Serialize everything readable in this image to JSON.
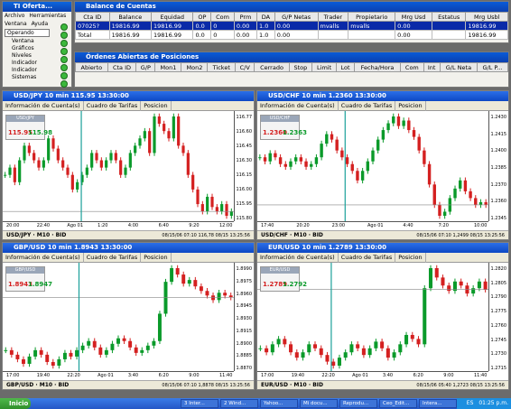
{
  "nav_panel": {
    "title": "TI Oferta...",
    "menu": [
      "Archivo",
      "Herramientas",
      "Ventana",
      "Ayuda"
    ],
    "dropdown": "Operando",
    "tree": [
      "Ventana",
      "Gráficos",
      "Niveles",
      "Indicador",
      "Indicador",
      "Sistemas"
    ]
  },
  "accounts": {
    "title": "Balance de Cuentas",
    "headers": [
      "Cta ID",
      "Balance",
      "Equidad",
      "OP",
      "Com",
      "Prm",
      "DA",
      "G/P Netas",
      "Trader",
      "Propietario",
      "Mrg Usd",
      "Estatus",
      "Mrg Usbl"
    ],
    "rows": [
      {
        "cells": [
          "07025?",
          "19816.99",
          "19816.99",
          "0.0",
          "0",
          "0.00",
          "1.0",
          "0.00",
          "mvalls",
          "mvalls",
          "0.00",
          "",
          "19816.99"
        ]
      },
      {
        "cells": [
          "Total",
          "19816.99",
          "19816.99",
          "0.0",
          "0",
          "0.00",
          "1.0",
          "0.00",
          "",
          "",
          "0.00",
          "",
          "19816.99"
        ]
      }
    ]
  },
  "orders": {
    "title": "Órdenes Abiertas de Posiciones",
    "headers": [
      "Abierto",
      "Cta ID",
      "G/P",
      "Mon1",
      "Mon2",
      "Ticket",
      "C/V",
      "Cerrado",
      "Stop",
      "Limit",
      "Lot",
      "Fecha/Hora",
      "Com",
      "Int",
      "G/L Neta",
      "G/L P..."
    ]
  },
  "charts": [
    {
      "title": "USD/JPY 10 min 115.95 13:30:00",
      "tabs": [
        "Información de Cuenta(s)",
        "Cuadro de Tarifas",
        "Posicion"
      ],
      "pair": "USD/JPY",
      "sell": "115.95",
      "buy": "115.98",
      "status": "USD/JPY · M10 · BID",
      "footer": "08/15/06 07:10  116,78  08/15 13:25:56",
      "yticks": [
        "116.77",
        "116.60",
        "116.45",
        "116.30",
        "116.15",
        "116.00",
        "115.95",
        "115.80"
      ],
      "xticks": [
        "20:00",
        "22:40",
        "Ago 01",
        "1:20",
        "4:00",
        "6:40",
        "9:20",
        "12:00"
      ],
      "last": "115.95",
      "prices": [
        116.2,
        116.25,
        116.15,
        116.3,
        116.4,
        116.35,
        116.3,
        116.25,
        116.3,
        116.45,
        116.38,
        116.3,
        116.25,
        116.2,
        116.1,
        116.15,
        116.2,
        116.25,
        116.35,
        116.3,
        116.25,
        116.3,
        116.35,
        116.3,
        116.2,
        116.25,
        116.35,
        116.4,
        116.45,
        116.5,
        116.35,
        116.6,
        116.55,
        116.5,
        116.45,
        116.6,
        116.4,
        116.35,
        116.2,
        116.1,
        116.0,
        115.95,
        116.05,
        115.98,
        115.95,
        116.0,
        115.92,
        115.95
      ]
    },
    {
      "title": "USD/CHF 10 min 1.2360 13:30:00",
      "tabs": [
        "Información de Cuenta(s)",
        "Cuadro de Tarifas",
        "Posicion"
      ],
      "pair": "USD/CHF",
      "sell": "1.2360",
      "buy": "1.2363",
      "status": "USD/CHF · M10 · BID",
      "footer": "08/15/06 07:10  1,2499  08/15 13:25:56",
      "yticks": [
        "1.2430",
        "1.2415",
        "1.2400",
        "1.2385",
        "1.2370",
        "1.2360",
        "1.2345"
      ],
      "xticks": [
        "17:40",
        "20:20",
        "23:00",
        "Ago 01",
        "4:40",
        "7:20",
        "10:00"
      ],
      "last": "1.2360",
      "prices": [
        1.2395,
        1.2392,
        1.2398,
        1.2395,
        1.239,
        1.2388,
        1.2392,
        1.2395,
        1.2392,
        1.2388,
        1.239,
        1.2395,
        1.2405,
        1.2412,
        1.2408,
        1.24,
        1.2395,
        1.239,
        1.2385,
        1.2378,
        1.2385,
        1.2392,
        1.24,
        1.2408,
        1.2415,
        1.242,
        1.2425,
        1.2418,
        1.2422,
        1.2415,
        1.241,
        1.24,
        1.239,
        1.2375,
        1.236,
        1.2352,
        1.2355,
        1.2365,
        1.2372,
        1.2378,
        1.237,
        1.2365,
        1.236,
        1.2362,
        1.236
      ]
    },
    {
      "title": "GBP/USD 10 min 1.8943 13:30:00",
      "tabs": [
        "Información de Cuenta(s)",
        "Cuadro de Tarifas",
        "Posicion"
      ],
      "pair": "GBP/USD",
      "sell": "1.8943",
      "buy": "1.8947",
      "status": "GBP/USD · M10 · BID",
      "footer": "08/15/06 07:10  1,8878  08/15 13:25:56",
      "yticks": [
        "1.8990",
        "1.8975",
        "1.8960",
        "1.8945",
        "1.8930",
        "1.8915",
        "1.8900",
        "1.8885",
        "1.8870"
      ],
      "xticks": [
        "17:00",
        "19:40",
        "22:20",
        "Ago 01",
        "3:40",
        "6:20",
        "9:00",
        "11:40"
      ],
      "last": "1.8943",
      "prices": [
        1.8885,
        1.888,
        1.8875,
        1.887,
        1.8878,
        1.8885,
        1.888,
        1.8872,
        1.8868,
        1.8875,
        1.8882,
        1.8878,
        1.8885,
        1.889,
        1.8895,
        1.8888,
        1.888,
        1.8885,
        1.8892,
        1.8898,
        1.8895,
        1.8888,
        1.8882,
        1.8885,
        1.889,
        1.8895,
        1.8925,
        1.896,
        1.8975,
        1.8968,
        1.8958,
        1.8962,
        1.8955,
        1.895,
        1.8945,
        1.894,
        1.8948,
        1.8945,
        1.8943
      ]
    },
    {
      "title": "EUR/USD 10 min 1.2789 13:30:00",
      "tabs": [
        "Información de Cuenta(s)",
        "Cuadro de Tarifas",
        "Posicion"
      ],
      "pair": "EUR/USD",
      "sell": "1.2789",
      "buy": "1.2792",
      "status": "EUR/USD · M10 · BID",
      "footer": "08/15/06 05:40  1,2723  08/15 13:25:56",
      "yticks": [
        "1.2820",
        "1.2805",
        "1.2790",
        "1.2775",
        "1.2760",
        "1.2745",
        "1.2730",
        "1.2715"
      ],
      "xticks": [
        "17:00",
        "19:40",
        "22:20",
        "Ago 01",
        "3:40",
        "6:20",
        "9:00",
        "11:40"
      ],
      "last": "1.2789",
      "prices": [
        1.2745,
        1.2742,
        1.2748,
        1.2752,
        1.2748,
        1.2742,
        1.2738,
        1.2742,
        1.2748,
        1.2745,
        1.274,
        1.2735,
        1.2732,
        1.2738,
        1.2742,
        1.2748,
        1.2745,
        1.274,
        1.2745,
        1.275,
        1.2745,
        1.2738,
        1.2742,
        1.2748,
        1.2755,
        1.2752,
        1.2748,
        1.279,
        1.2805,
        1.2798,
        1.2792,
        1.2788,
        1.2795,
        1.2792,
        1.2786,
        1.279,
        1.2795,
        1.2789
      ]
    }
  ],
  "taskbar": {
    "start": "Inicio",
    "buttons": [
      "3 Inter...",
      "2 Wind...",
      "Yahoo...",
      "Mi docu...",
      "Reprodu...",
      "Ceo_Edit...",
      "Intera..."
    ],
    "lang": "ES",
    "clock": "01:25 p.m."
  },
  "colors": {
    "bull": "#0a9a2a",
    "bear": "#d42020",
    "vline": "#1aa09a"
  }
}
